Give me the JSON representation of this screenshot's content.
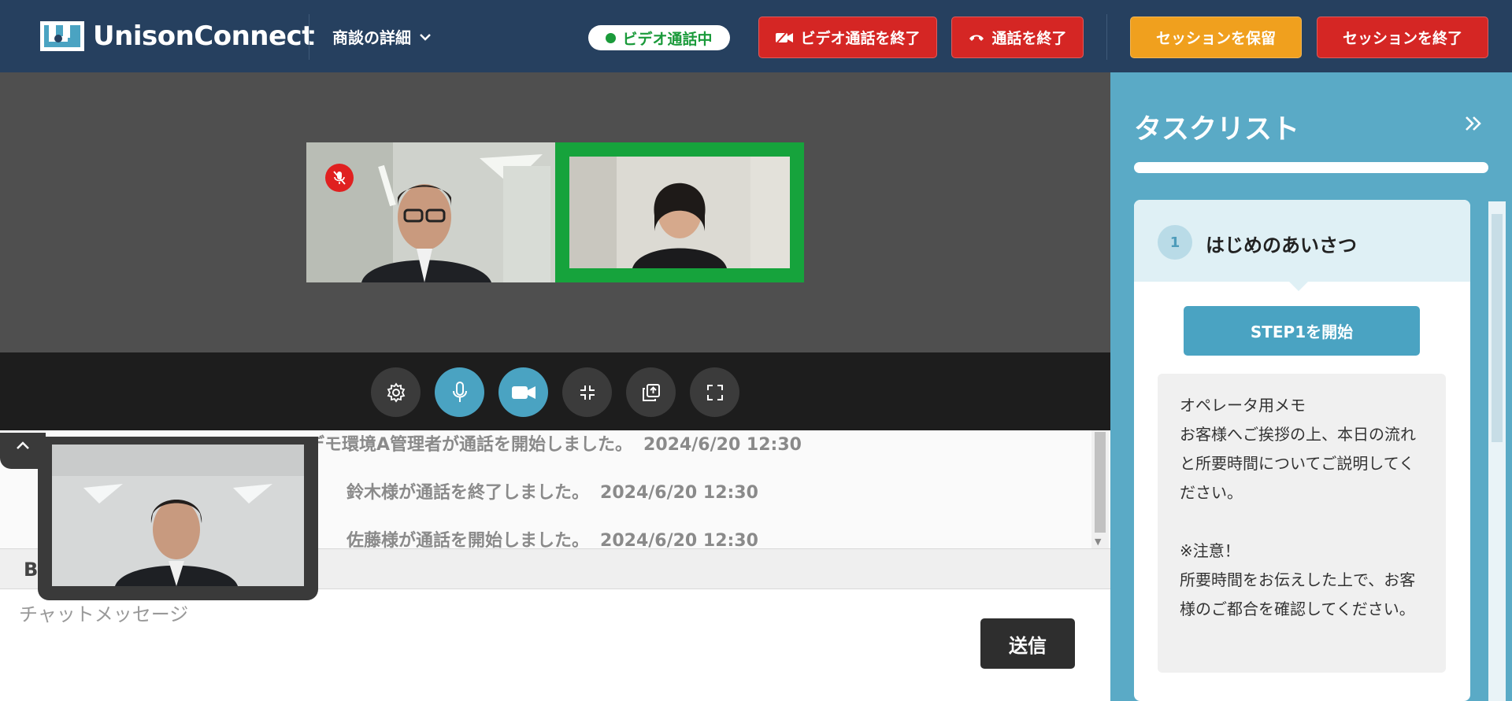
{
  "header": {
    "logo_text": "UnisonConnect",
    "deal_detail_label": "商談の詳細",
    "status_label": "ビデオ通話中",
    "end_video_label": "ビデオ通話を終了",
    "end_call_label": "通話を終了",
    "hold_session_label": "セッションを保留",
    "end_session_label": "セッションを終了",
    "colors": {
      "bar": "#26405f",
      "danger": "#d52624",
      "warning": "#f0a01e",
      "live": "#1a9a3a"
    }
  },
  "video": {
    "participants": [
      {
        "name": "operator-tile",
        "muted": true
      },
      {
        "name": "customer-tile",
        "speaking": true
      }
    ],
    "controls": [
      "gear-icon",
      "mic-icon",
      "camera-icon",
      "minimize-icon",
      "popout-icon",
      "fullscreen-icon"
    ]
  },
  "chat": {
    "log": [
      {
        "message": "デモ環境A管理者が通話を開始しました。",
        "timestamp": "2024/6/20 12:30"
      },
      {
        "message": "鈴木様が通話を終了しました。",
        "timestamp": "2024/6/20 12:30"
      },
      {
        "message": "佐藤様が通話を開始しました。",
        "timestamp": "2024/6/20 12:30"
      }
    ],
    "bold_label": "B",
    "placeholder": "チャットメッセージ",
    "send_label": "送信"
  },
  "tasks": {
    "title": "タスクリスト",
    "steps": [
      {
        "number": "1",
        "title": "はじめのあいさつ",
        "start_label": "STEP1を開始",
        "memo": "オペレータ用メモ\nお客様へご挨拶の上、本日の流れと所要時間についてご説明してください。\n\n※注意！\n所要時間をお伝えした上で、お客様のご都合を確認してください。"
      }
    ]
  }
}
